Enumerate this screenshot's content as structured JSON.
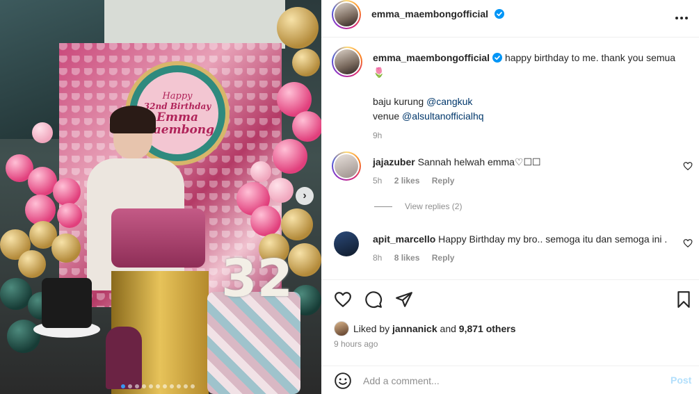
{
  "post": {
    "username": "emma_maembongofficial",
    "verified": true,
    "more_icon": "more-horizontal-icon",
    "photo": {
      "sign_line1": "Happy",
      "sign_line2": "32nd Birthday",
      "sign_line3": "Emma",
      "sign_line4": "Maembong",
      "cake_number": "32",
      "carousel_count": 11,
      "carousel_active": 1
    },
    "caption": {
      "username": "emma_maembongofficial",
      "text": "happy birthday to me. thank you semua 🌷",
      "line_baju_prefix": "baju kurung",
      "line_baju_mention": "@cangkuk",
      "line_venue_prefix": "venue",
      "line_venue_mention": "@alsultanofficialhq",
      "time": "9h"
    },
    "comments": [
      {
        "username": "jajazuber",
        "text": "Sannah helwah emma♡☐☐",
        "time": "5h",
        "likes": "2 likes",
        "reply": "Reply",
        "view_replies": "View replies (2)"
      },
      {
        "username": "apit_marcello",
        "text": "Happy Birthday my bro.. semoga itu dan semoga ini .",
        "time": "8h",
        "likes": "8 likes",
        "reply": "Reply"
      }
    ],
    "likes_summary": {
      "prefix": "Liked by",
      "user": "jannanick",
      "middle": "and",
      "others": "9,871 others"
    },
    "time_ago": "9 hours ago",
    "add_comment": {
      "placeholder": "Add a comment...",
      "post_label": "Post"
    },
    "colors": {
      "link": "#00376b",
      "muted": "#8e8e8e",
      "post_disabled": "#b2dffc",
      "verified_blue": "#0095f6"
    }
  }
}
